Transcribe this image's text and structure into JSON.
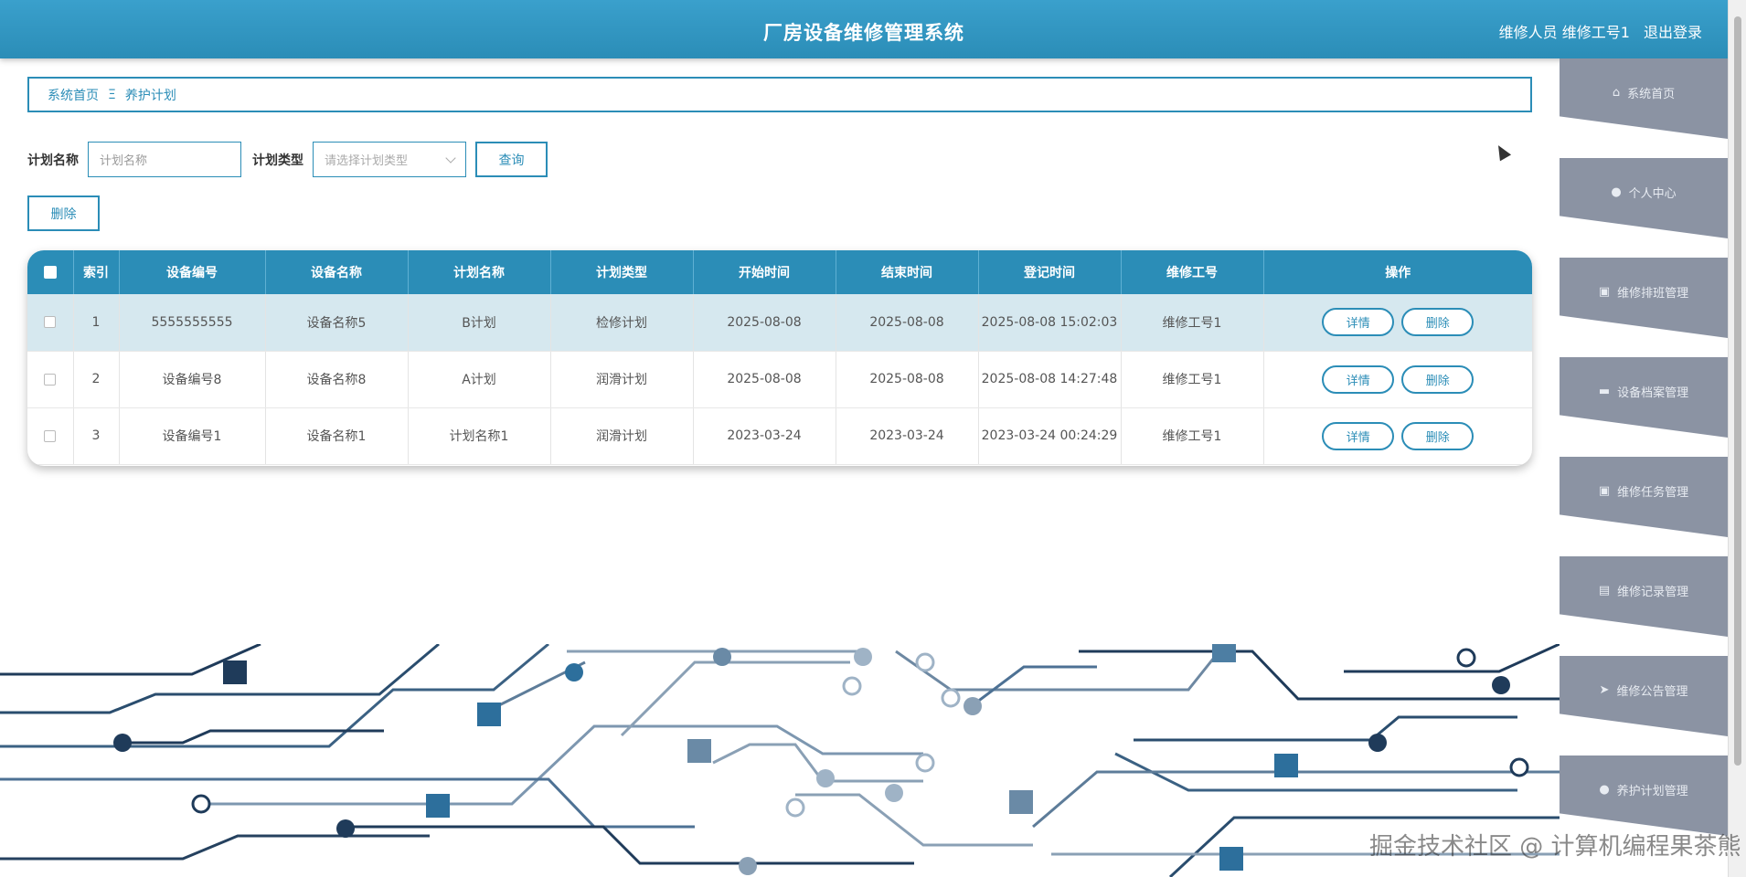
{
  "header": {
    "title": "厂房设备维修管理系统",
    "user": "维修人员 维修工号1",
    "logout": "退出登录"
  },
  "breadcrumb": {
    "home": "系统首页",
    "separator": "Ξ",
    "current": "养护计划"
  },
  "search": {
    "name_label": "计划名称",
    "name_placeholder": "计划名称",
    "type_label": "计划类型",
    "type_placeholder": "请选择计划类型",
    "query_button": "查询"
  },
  "actions": {
    "delete_button": "删除"
  },
  "table": {
    "headers": [
      "",
      "索引",
      "设备编号",
      "设备名称",
      "计划名称",
      "计划类型",
      "开始时间",
      "结束时间",
      "登记时间",
      "维修工号",
      "操作"
    ],
    "rows": [
      {
        "index": "1",
        "device_no": "5555555555",
        "device_name": "设备名称5",
        "plan_name": "B计划",
        "plan_type": "检修计划",
        "start": "2025-08-08",
        "end": "2025-08-08",
        "registered": "2025-08-08 15:02:03",
        "worker": "维修工号1",
        "detail": "详情",
        "delete": "删除"
      },
      {
        "index": "2",
        "device_no": "设备编号8",
        "device_name": "设备名称8",
        "plan_name": "A计划",
        "plan_type": "润滑计划",
        "start": "2025-08-08",
        "end": "2025-08-08",
        "registered": "2025-08-08 14:27:48",
        "worker": "维修工号1",
        "detail": "详情",
        "delete": "删除"
      },
      {
        "index": "3",
        "device_no": "设备编号1",
        "device_name": "设备名称1",
        "plan_name": "计划名称1",
        "plan_type": "润滑计划",
        "start": "2023-03-24",
        "end": "2023-03-24",
        "registered": "2023-03-24 00:24:29",
        "worker": "维修工号1",
        "detail": "详情",
        "delete": "删除"
      }
    ]
  },
  "sidebar": {
    "items": [
      {
        "label": "系统首页",
        "icon": "home-icon"
      },
      {
        "label": "个人中心",
        "icon": "user-icon"
      },
      {
        "label": "维修排班管理",
        "icon": "clipboard-icon"
      },
      {
        "label": "设备档案管理",
        "icon": "ticket-icon"
      },
      {
        "label": "维修任务管理",
        "icon": "clipboard-icon"
      },
      {
        "label": "维修记录管理",
        "icon": "printer-icon"
      },
      {
        "label": "维修公告管理",
        "icon": "send-icon"
      },
      {
        "label": "养护计划管理",
        "icon": "user-icon"
      }
    ]
  },
  "watermark": "掘金技术社区 @ 计算机编程果茶熊"
}
